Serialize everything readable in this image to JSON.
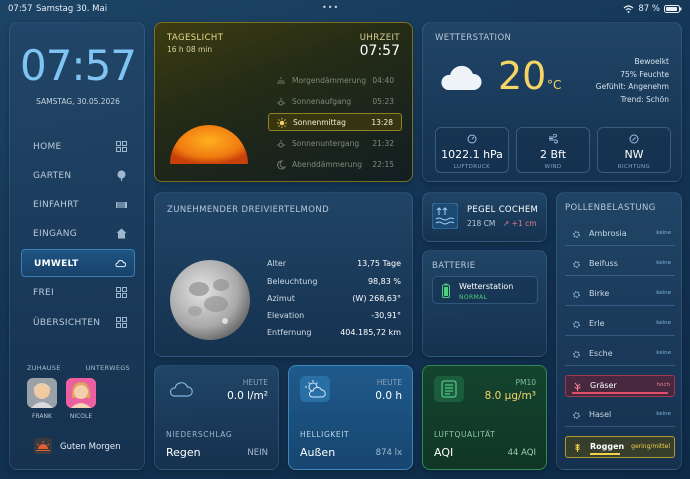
{
  "status": {
    "time": "07:57",
    "date": "Samstag 30. Mai",
    "battery": "87 %"
  },
  "sidebar": {
    "clock": "07:57",
    "date": "SAMSTAG, 30.05.2026",
    "nav": [
      {
        "label": "HOME",
        "icon": "grid-icon"
      },
      {
        "label": "GARTEN",
        "icon": "tree-icon"
      },
      {
        "label": "EINFAHRT",
        "icon": "gate-icon"
      },
      {
        "label": "EINGANG",
        "icon": "house-icon"
      },
      {
        "label": "UMWELT",
        "icon": "cloud-icon",
        "active": true
      },
      {
        "label": "FREI",
        "icon": "grid-icon"
      },
      {
        "label": "ÜBERSICHTEN",
        "icon": "grid-icon"
      }
    ],
    "presence": {
      "home_label": "ZUHAUSE",
      "away_label": "UNTERWEGS"
    },
    "people": [
      {
        "name": "FRANK"
      },
      {
        "name": "NICOLE"
      }
    ],
    "greeting": "Guten Morgen"
  },
  "daylight": {
    "title": "TAGESLICHT",
    "duration": "16 h 08 min",
    "time_label": "UHRZEIT",
    "time": "07:57",
    "rows": [
      {
        "name": "Morgendämmerung",
        "time": "04:40"
      },
      {
        "name": "Sonnenaufgang",
        "time": "05:23"
      },
      {
        "name": "Sonnenmittag",
        "time": "13:28",
        "highlight": true
      },
      {
        "name": "Sonnenuntergang",
        "time": "21:32"
      },
      {
        "name": "Abenddämmerung",
        "time": "22:15"
      }
    ]
  },
  "weather": {
    "title": "WETTERSTATION",
    "temp": "20",
    "unit": "°C",
    "details": [
      "Bewoelkt",
      "75% Feuchte",
      "Gefühlt: Angenehm",
      "Trend: Schön"
    ],
    "boxes": [
      {
        "value": "1022.1 hPa",
        "label": "LUFTDRUCK",
        "icon": "gauge-icon"
      },
      {
        "value": "2 Bft",
        "label": "WIND",
        "icon": "wind-icon"
      },
      {
        "value": "NW",
        "label": "RICHTUNG",
        "icon": "compass-icon"
      }
    ]
  },
  "moon": {
    "title": "ZUNEHMENDER DREIVIERTELMOND",
    "rows": [
      {
        "key": "Alter",
        "value": "13,75 Tage"
      },
      {
        "key": "Beleuchtung",
        "value": "98,83 %"
      },
      {
        "key": "Azimut",
        "value": "(W) 268,63°"
      },
      {
        "key": "Elevation",
        "value": "-30,91°"
      },
      {
        "key": "Entfernung",
        "value": "404.185,72 km"
      }
    ]
  },
  "pegel": {
    "title": "PEGEL COCHEM",
    "level": "218 CM",
    "trend": "+1 cm"
  },
  "battery": {
    "title": "BATTERIE",
    "device": "Wetterstation",
    "state": "NORMAL"
  },
  "pollen": {
    "title": "POLLENBELASTUNG",
    "items": [
      {
        "name": "Ambrosia",
        "level": "keine"
      },
      {
        "name": "Beifuss",
        "level": "keine"
      },
      {
        "name": "Birke",
        "level": "keine"
      },
      {
        "name": "Erle",
        "level": "keine"
      },
      {
        "name": "Esche",
        "level": "keine"
      },
      {
        "name": "Gräser",
        "level": "hoch",
        "alert": true
      },
      {
        "name": "Hasel",
        "level": "keine"
      },
      {
        "name": "Roggen",
        "level": "gering/mittel",
        "warn": true
      }
    ]
  },
  "tiles": [
    {
      "header": "HEUTE",
      "value": "0.0 l/m²",
      "category": "NIEDERSCHLAG",
      "name": "Regen",
      "sub": "NEIN"
    },
    {
      "header": "HEUTE",
      "value": "0.0 h",
      "category": "HELLIGKEIT",
      "name": "Außen",
      "sub": "874 lx"
    },
    {
      "header": "PM10",
      "value": "8.0 µg/m³",
      "category": "LUFTQUALITÄT",
      "name": "AQI",
      "sub": "44 AQI"
    }
  ]
}
